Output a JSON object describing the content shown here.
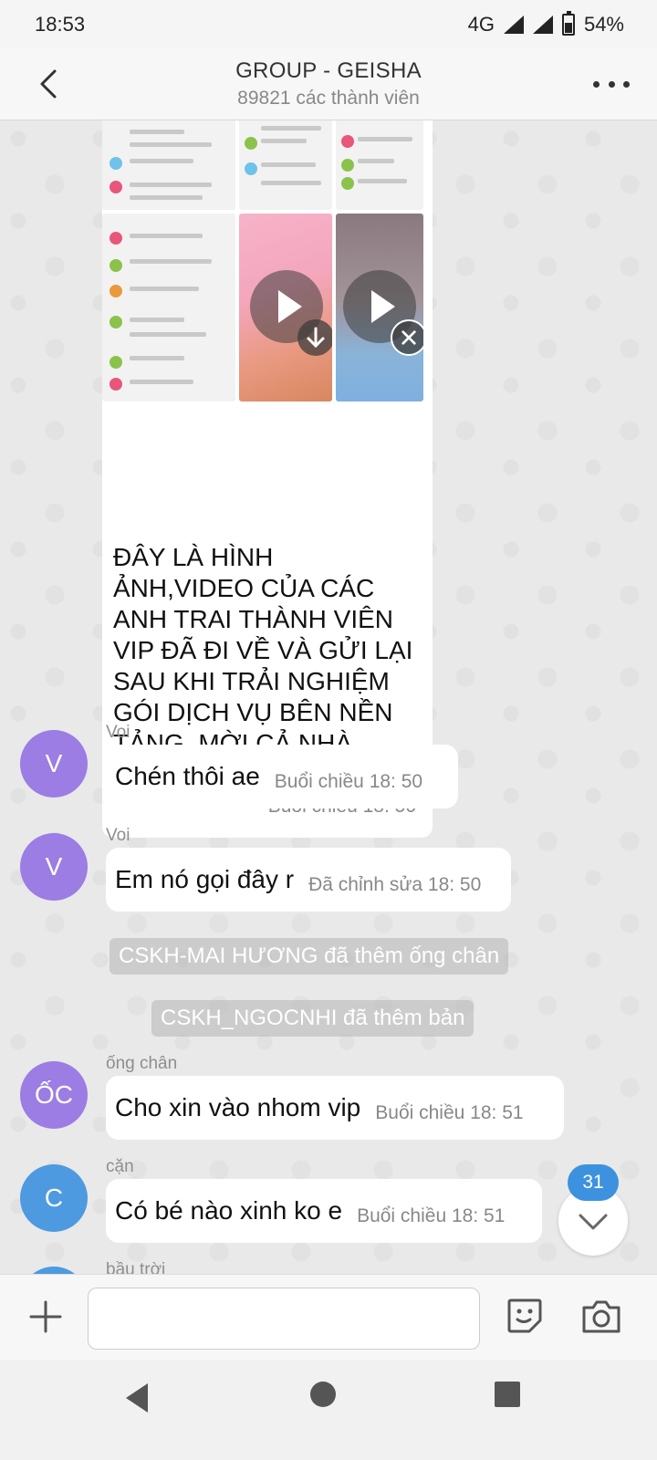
{
  "status_bar": {
    "time": "18:53",
    "network": "4G",
    "battery": "54%"
  },
  "header": {
    "title": "GROUP - GEISHA",
    "subtitle": "89821 các thành viên"
  },
  "media_message": {
    "text": "ĐÂY LÀ HÌNH ẢNH,VIDEO CỦA CÁC ANH TRAI THÀNH VIÊN VIP ĐÃ ĐI VỀ VÀ GỬI LẠI SAU KHI TRẢI NGHIỆM GÓI DỊCH VỤ BÊN NỀN TẢNG, MỜI CẢ NHÀ CÙNG XEM NHÉ !!",
    "time": "Buổi chiều  18: 50"
  },
  "messages": [
    {
      "sender": "Voi",
      "avatar": "V",
      "text": "Chén thôi ae",
      "time": "Buổi chiều  18: 50"
    },
    {
      "sender": "Voi",
      "avatar": "V",
      "text": "Em nó gọi đây r",
      "time": "Đã chỉnh sửa 18: 50"
    },
    {
      "sender": "ống chân",
      "avatar": "ỐC",
      "text": "Cho xin vào nhom vip",
      "time": "Buổi chiều  18: 51"
    },
    {
      "sender": "cặn",
      "avatar": "C",
      "text": "Có bé nào xinh ko e",
      "time": "Buổi chiều  18: 51"
    },
    {
      "sender": "bầu trời"
    }
  ],
  "system_messages": [
    "CSKH-MAI HƯƠNG đã thêm ống chân",
    "CSKH_NGOCNHI đã thêm bản"
  ],
  "unread_badge": "31",
  "colors": {
    "avatar_purple": "#9b7de3",
    "avatar_blue": "#4d9ae0",
    "badge_blue": "#3d92df"
  }
}
